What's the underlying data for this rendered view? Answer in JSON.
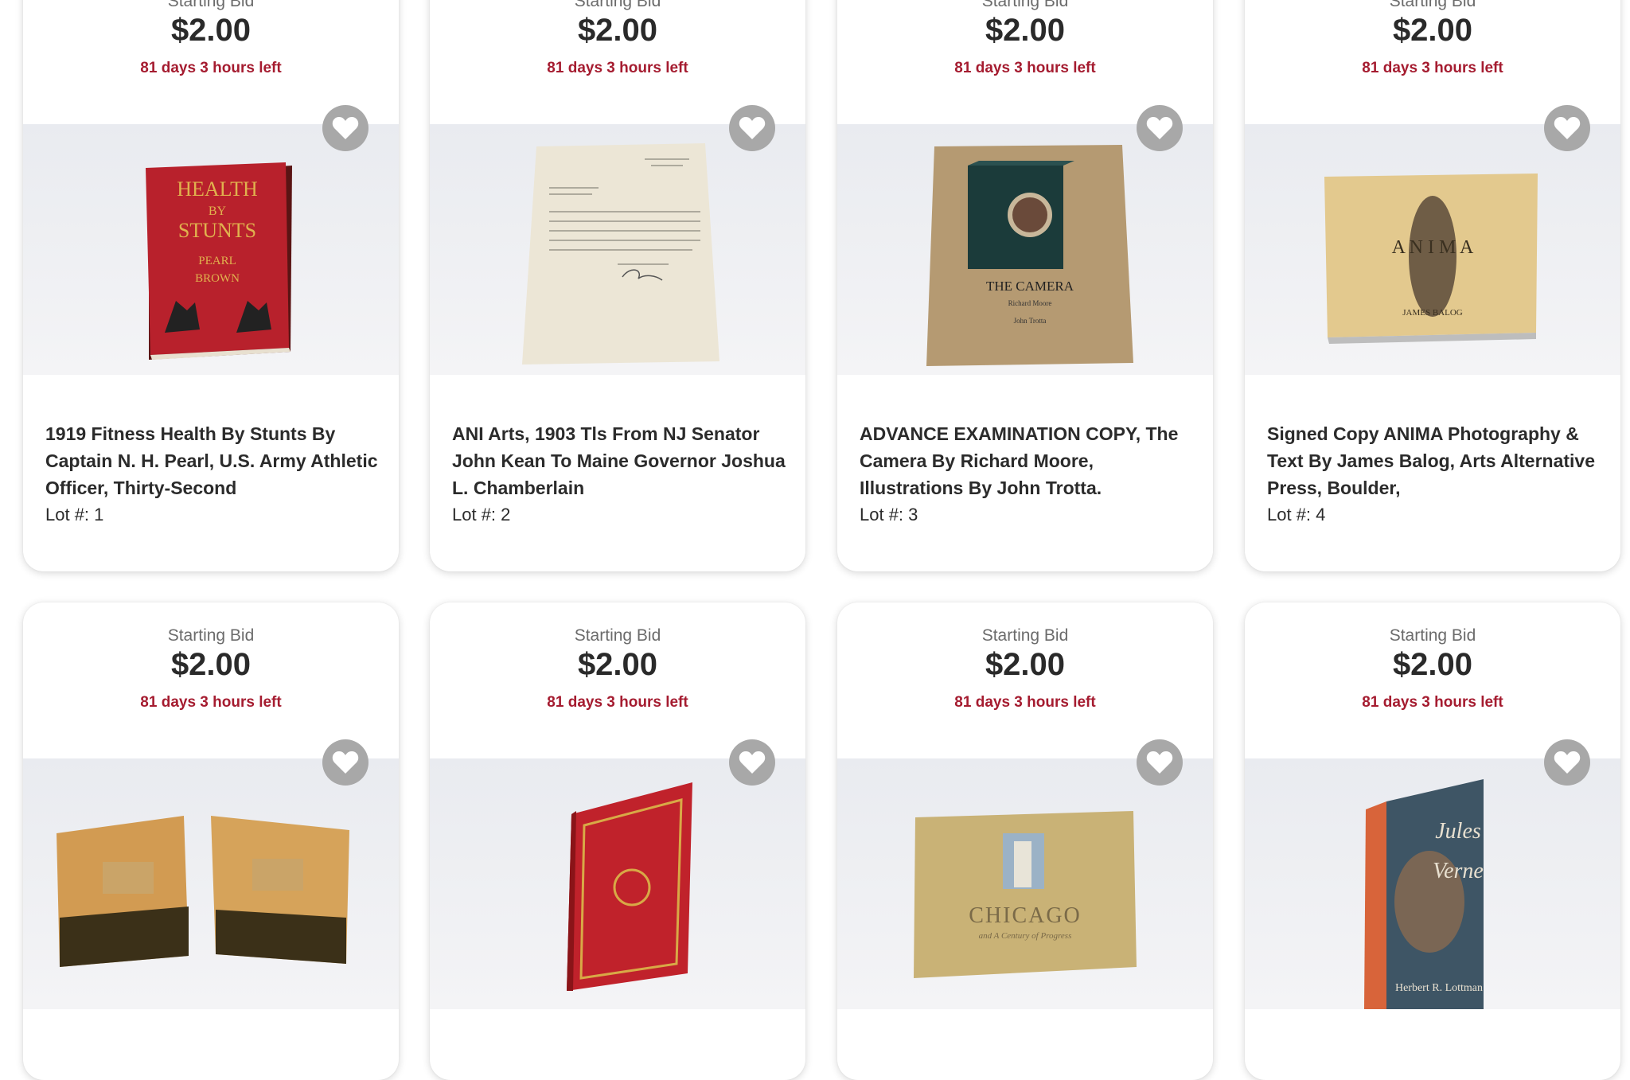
{
  "colors": {
    "time_left": "#a51c30",
    "price": "#2a2a2a",
    "favorite_button": "#a8a8a8"
  },
  "lots": [
    {
      "bid_label": "Starting Bid",
      "price": "$2.00",
      "time_left": "81 days 3 hours left",
      "title": "1919 Fitness Health By Stunts By Captain N. H. Pearl, U.S. Army Athletic Officer, Thirty-Second",
      "lot_number": "Lot #: 1",
      "image_icon": "red-book-health-by-stunts",
      "cover_text": [
        "HEALTH",
        "BY",
        "STUNTS",
        "PEARL",
        "BROWN"
      ]
    },
    {
      "bid_label": "Starting Bid",
      "price": "$2.00",
      "time_left": "81 days 3 hours left",
      "title": "ANI Arts, 1903 Tls From NJ Senator John Kean To Maine Governor Joshua L. Chamberlain",
      "lot_number": "Lot #: 2",
      "image_icon": "typed-letter"
    },
    {
      "bid_label": "Starting Bid",
      "price": "$2.00",
      "time_left": "81 days 3 hours left",
      "title": "ADVANCE EXAMINATION COPY, The Camera By Richard Moore, Illustrations By John Trotta.",
      "lot_number": "Lot #: 3",
      "image_icon": "book-the-camera",
      "cover_text": [
        "THE CAMERA",
        "Richard Moore",
        "John Trotta"
      ]
    },
    {
      "bid_label": "Starting Bid",
      "price": "$2.00",
      "time_left": "81 days 3 hours left",
      "title": "Signed Copy ANIMA Photography & Text By James Balog, Arts Alternative Press, Boulder,",
      "lot_number": "Lot #: 4",
      "image_icon": "book-anima",
      "cover_text": [
        "A  N  I  M  A",
        "JAMES BALOG"
      ]
    },
    {
      "bid_label": "Starting Bid",
      "price": "$2.00",
      "time_left": "81 days 3 hours left",
      "image_icon": "two-books-chinese"
    },
    {
      "bid_label": "Starting Bid",
      "price": "$2.00",
      "time_left": "81 days 3 hours left",
      "image_icon": "red-leather-book"
    },
    {
      "bid_label": "Starting Bid",
      "price": "$2.00",
      "time_left": "81 days 3 hours left",
      "image_icon": "book-chicago",
      "cover_text": [
        "CHICAGO",
        "and A Century of Progress"
      ]
    },
    {
      "bid_label": "Starting Bid",
      "price": "$2.00",
      "time_left": "81 days 3 hours left",
      "image_icon": "book-jules-verne",
      "cover_text": [
        "Jules",
        "Verne",
        "Herbert R. Lottman"
      ]
    }
  ]
}
